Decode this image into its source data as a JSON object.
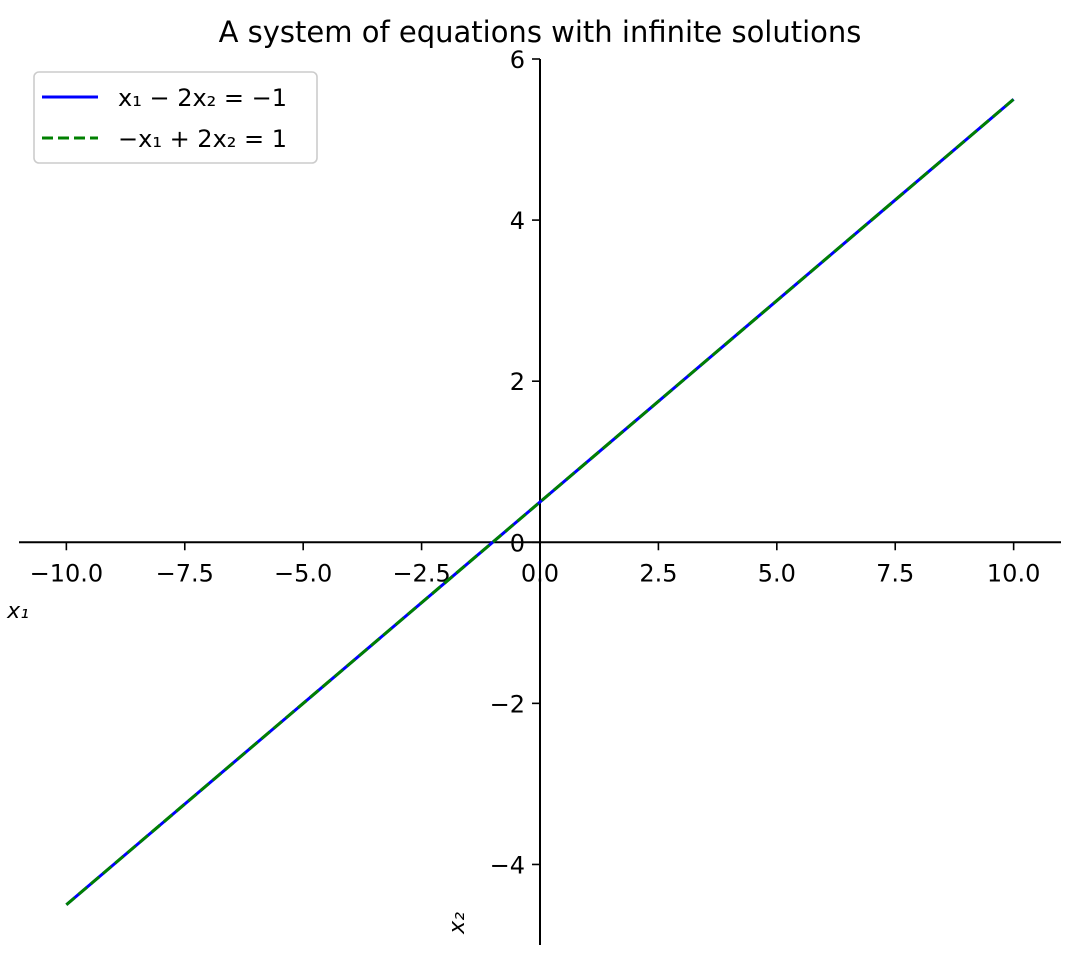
{
  "chart_data": {
    "type": "line",
    "title": "A system of equations with infinite solutions",
    "xlabel": "x₁",
    "ylabel": "x₂",
    "xlim": [
      -11,
      11
    ],
    "ylim": [
      -5,
      6
    ],
    "xticks": [
      -10,
      -7.5,
      -5,
      -2.5,
      0,
      2.5,
      5,
      7.5,
      10
    ],
    "xtick_labels": [
      "−10.0",
      "−7.5",
      "−5.0",
      "−2.5",
      "0.0",
      "2.5",
      "5.0",
      "7.5",
      "10.0"
    ],
    "yticks": [
      -4,
      -2,
      0,
      2,
      4,
      6
    ],
    "ytick_labels": [
      "−4",
      "−2",
      "0",
      "2",
      "4",
      "6"
    ],
    "grid": false,
    "legend_position": "upper-left",
    "spines": "centered at origin",
    "series": [
      {
        "name": "x₁ − 2x₂ = −1",
        "color": "#0000ff",
        "style": "solid",
        "x": [
          -10,
          10
        ],
        "y": [
          -4.5,
          5.5
        ]
      },
      {
        "name": "−x₁ + 2x₂ = 1",
        "color": "#008000",
        "style": "dashed",
        "x": [
          -10,
          10
        ],
        "y": [
          -4.5,
          5.5
        ]
      }
    ]
  }
}
